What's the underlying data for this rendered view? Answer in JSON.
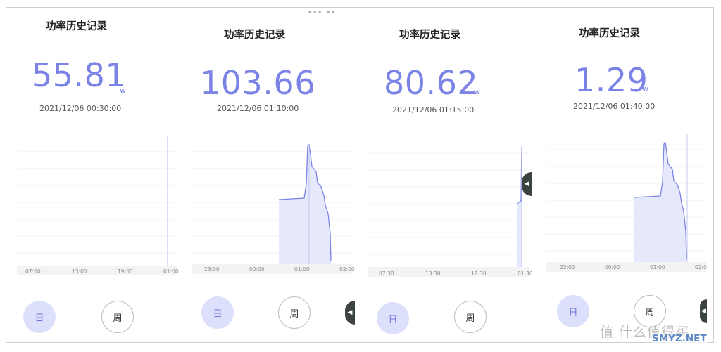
{
  "status_bar_text": "▪▪▪ ▪▪",
  "panels": [
    {
      "title": "功率历史记录",
      "value": "55.81",
      "unit": "w",
      "time": "2021/12/06 00:30:00",
      "x_ticks": [
        "07:00",
        "13:00",
        "19:00",
        "01:00"
      ],
      "day_label": "日",
      "week_label": "周"
    },
    {
      "title": "功率历史记录",
      "value": "103.66",
      "unit": "w",
      "time": "2021/12/06 01:10:00",
      "x_ticks": [
        "23:00",
        "00:00",
        "01:00",
        "02:00"
      ],
      "day_label": "日",
      "week_label": "周"
    },
    {
      "title": "功率历史记录",
      "value": "80.62",
      "unit": "w",
      "time": "2021/12/06 01:15:00",
      "x_ticks": [
        "07:30",
        "13:30",
        "19:30",
        "01:30"
      ],
      "day_label": "日",
      "week_label": "周"
    },
    {
      "title": "功率历史记录",
      "value": "1.29",
      "unit": "w",
      "time": "2021/12/06 01:40:00",
      "x_ticks": [
        "23:00",
        "00:00",
        "01:00",
        "02:0"
      ],
      "day_label": "日",
      "week_label": "周"
    }
  ],
  "watermark": {
    "text": "值 什么值得买",
    "site": "SMYZ.NET"
  },
  "colors": {
    "accent": "#7b84e6",
    "chart_fill": "#e6e8fb",
    "day_button_bg": "#dde0fb",
    "handle": "#3c4440"
  }
}
